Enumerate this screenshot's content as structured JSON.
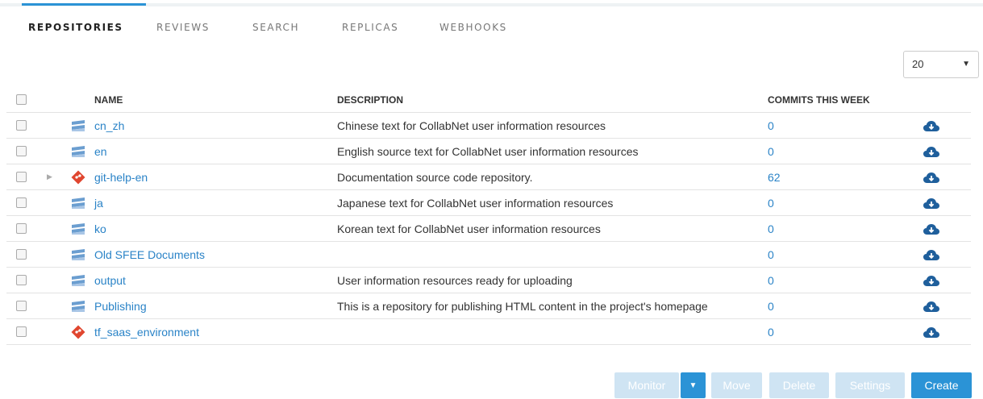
{
  "tabs": [
    {
      "label": "REPOSITORIES",
      "active": true
    },
    {
      "label": "REVIEWS",
      "active": false
    },
    {
      "label": "SEARCH",
      "active": false
    },
    {
      "label": "REPLICAS",
      "active": false
    },
    {
      "label": "WEBHOOKS",
      "active": false
    }
  ],
  "page_size": {
    "value": "20"
  },
  "table": {
    "headers": {
      "name": "NAME",
      "description": "DESCRIPTION",
      "commits": "COMMITS THIS WEEK"
    },
    "rows": [
      {
        "name": "cn_zh",
        "description": "Chinese text for CollabNet user information resources",
        "commits": "0",
        "type": "svn-icon",
        "expandable": false
      },
      {
        "name": "en",
        "description": "English source text for CollabNet user information resources",
        "commits": "0",
        "type": "svn-icon",
        "expandable": false
      },
      {
        "name": "git-help-en",
        "description": "Documentation source code repository.",
        "commits": "62",
        "type": "git-icon",
        "expandable": true
      },
      {
        "name": "ja",
        "description": "Japanese text for CollabNet user information resources",
        "commits": "0",
        "type": "svn-icon",
        "expandable": false
      },
      {
        "name": "ko",
        "description": "Korean text for CollabNet user information resources",
        "commits": "0",
        "type": "svn-icon",
        "expandable": false
      },
      {
        "name": "Old SFEE Documents",
        "description": "",
        "commits": "0",
        "type": "svn-icon",
        "expandable": false
      },
      {
        "name": "output",
        "description": "User information resources ready for uploading",
        "commits": "0",
        "type": "svn-icon",
        "expandable": false
      },
      {
        "name": "Publishing",
        "description": "This is a repository for publishing HTML content in the project's homepage",
        "commits": "0",
        "type": "svn-icon",
        "expandable": false
      },
      {
        "name": "tf_saas_environment",
        "description": "",
        "commits": "0",
        "type": "git-icon",
        "expandable": false
      }
    ]
  },
  "buttons": {
    "monitor": "Monitor",
    "move": "Move",
    "delete": "Delete",
    "settings": "Settings",
    "create": "Create"
  },
  "colors": {
    "accent": "#2b93d6",
    "link": "#2a83c7",
    "git": "#e0462f",
    "svn": "#6b9ed0",
    "disabled_button": "#cfe4f3"
  }
}
